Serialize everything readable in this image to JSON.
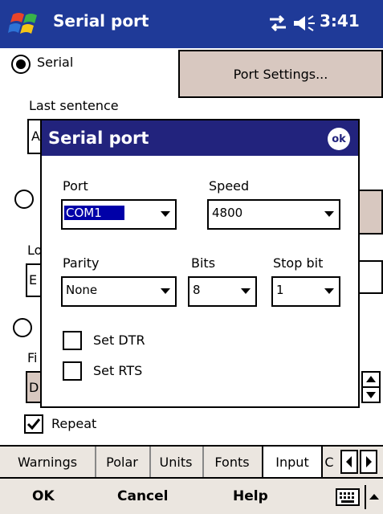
{
  "titlebar": {
    "title": "Serial port",
    "time": "3:41",
    "icons": [
      "windows-start-icon",
      "connectivity-icon",
      "speaker-icon"
    ]
  },
  "form": {
    "serial_label": "Serial",
    "port_settings_label": "Port Settings...",
    "last_sentence_label": "Last sentence",
    "last_sentence_value": "A",
    "lo_label": "Lo",
    "lo_value": "E",
    "fi_label": "Fi",
    "fi_value": "D",
    "repeat_label": "Repeat"
  },
  "dialog": {
    "title": "Serial port",
    "ok_label": "ok",
    "port": {
      "label": "Port",
      "value": "COM1"
    },
    "speed": {
      "label": "Speed",
      "value": "4800"
    },
    "parity": {
      "label": "Parity",
      "value": "None"
    },
    "bits": {
      "label": "Bits",
      "value": "8"
    },
    "stop_bit": {
      "label": "Stop bit",
      "value": "1"
    },
    "set_dtr_label": "Set DTR",
    "set_rts_label": "Set RTS"
  },
  "tabs": [
    "Warnings",
    "Polar",
    "Units",
    "Fonts",
    "Input",
    "C"
  ],
  "selected_tab": "Input",
  "menubar": {
    "ok": "OK",
    "cancel": "Cancel",
    "help": "Help"
  },
  "colors": {
    "titlebar": "#1f3a98",
    "dialog_header": "#22237d",
    "button_bg": "#d8c8c0",
    "bar_bg": "#ebe6e0",
    "selection": "#0000a8"
  }
}
